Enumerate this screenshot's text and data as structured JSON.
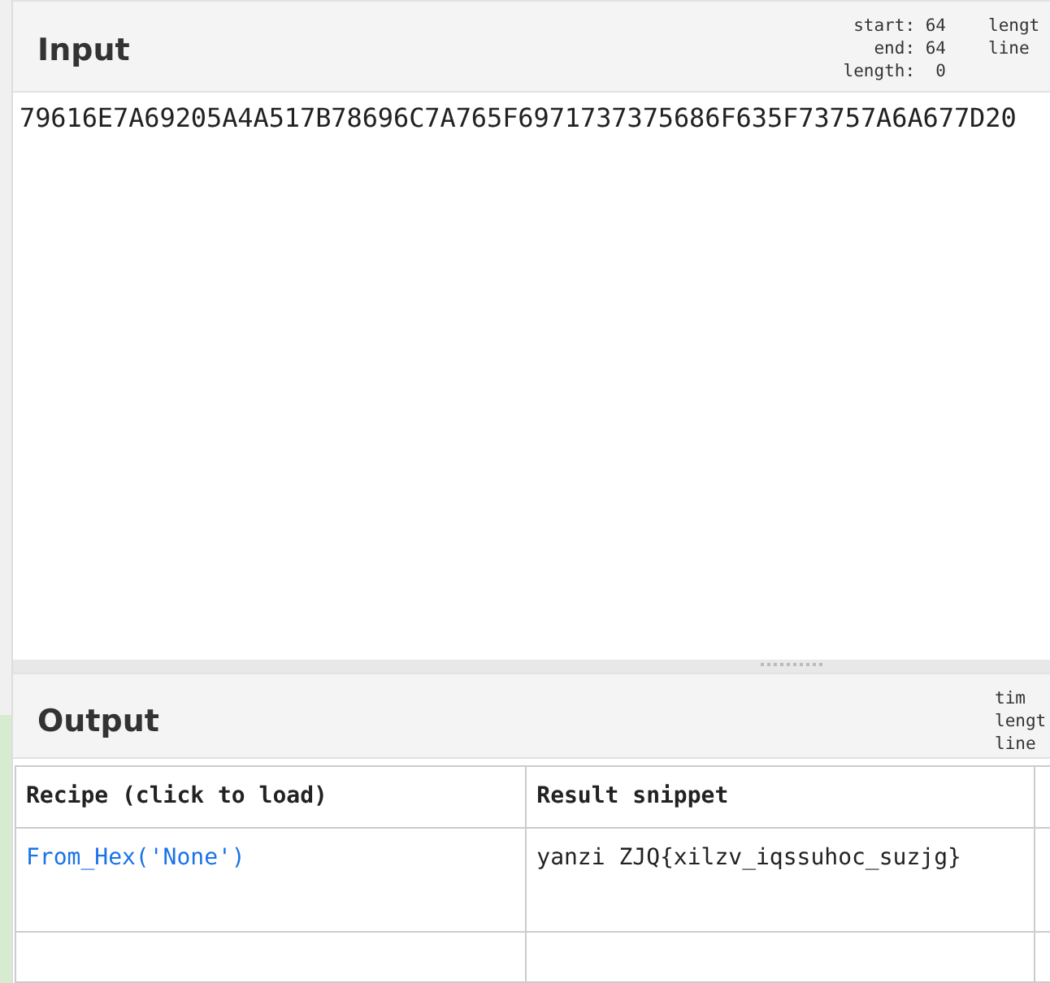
{
  "input": {
    "title": "Input",
    "stats": [
      "start: 64",
      "end: 64",
      "length:  0"
    ],
    "stats_cut": [
      "lengt",
      "line"
    ],
    "value": "79616E7A69205A4A517B78696C7A765F6971737375686F635F73757A6A677D20"
  },
  "output": {
    "title": "Output",
    "stats_cut": [
      "tim",
      "lengt",
      "line"
    ],
    "table": {
      "columns": [
        "Recipe (click to load)",
        "Result snippet"
      ],
      "rows": [
        {
          "recipe": "From_Hex('None')",
          "result": "yanzi ZJQ{xilzv_iqssuhoc_suzjg}"
        }
      ]
    }
  }
}
